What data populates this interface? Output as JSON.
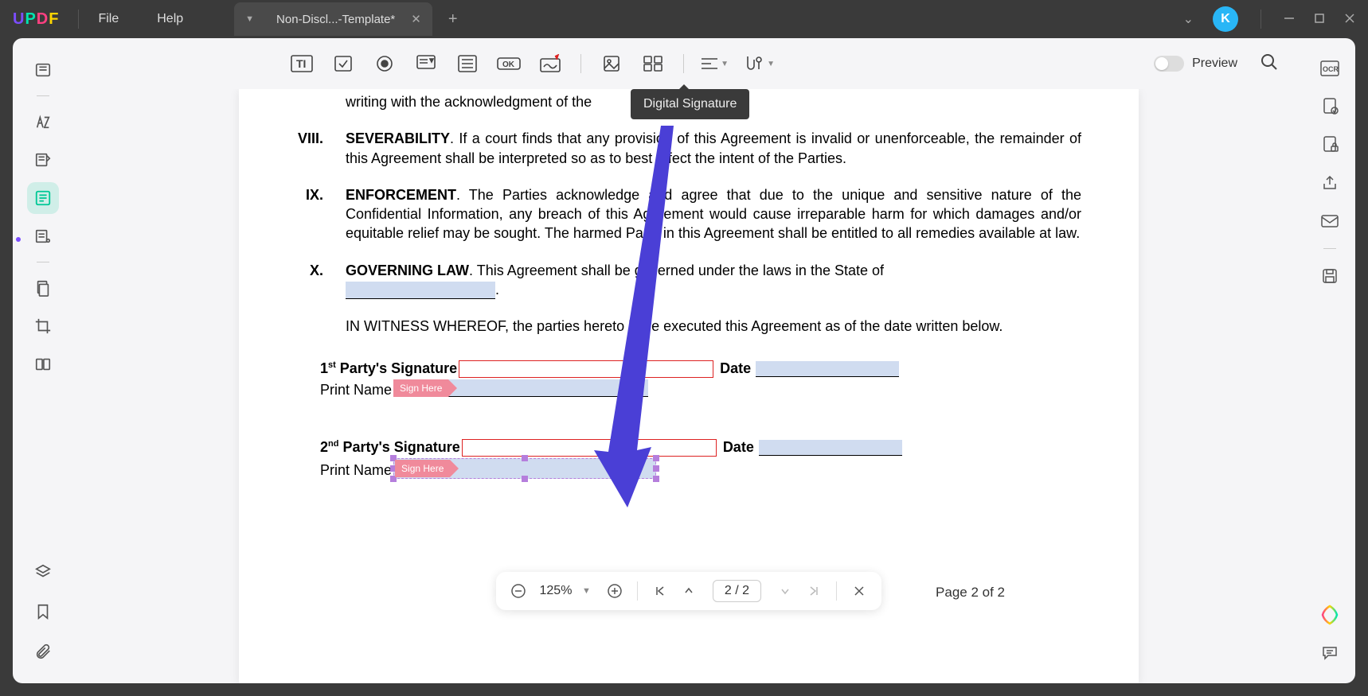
{
  "app": {
    "logo": "UPDF"
  },
  "menu": {
    "file": "File",
    "help": "Help"
  },
  "tab": {
    "title": "Non-Discl...-Template*"
  },
  "avatar": {
    "initial": "K"
  },
  "tooltip": {
    "digital_signature": "Digital Signature"
  },
  "preview": {
    "label": "Preview"
  },
  "document": {
    "writing_line": "writing with the acknowledgment of the",
    "sections": {
      "viii": {
        "num": "VIII.",
        "title": "SEVERABILITY",
        "body_after": ". If a court finds that any provision of this Agreement is invalid or unenforceable, the remainder of this Agreement shall be interpreted so as to best affect the intent of the Parties."
      },
      "ix": {
        "num": "IX.",
        "title": "ENFORCEMENT",
        "body_after": ". The Parties acknowledge and agree that due to the unique and sensitive nature of the Confidential Information, any breach of this Agreement would cause irreparable harm for which damages and/or equitable relief may be sought. The harmed Party in this Agreement shall be entitled to all remedies available at law."
      },
      "x": {
        "num": "X.",
        "title": "GOVERNING LAW",
        "body_after": ". This Agreement shall be governed under the laws in the State of "
      }
    },
    "witness": "IN WITNESS WHEREOF, the parties hereto have executed this Agreement as of the date written below.",
    "sig1": {
      "ord": "1",
      "sup": "st",
      "label": " Party's Signature",
      "date": "Date",
      "print": "Print Name",
      "sign_here": "Sign Here"
    },
    "sig2": {
      "ord": "2",
      "sup": "nd",
      "label": " Party's Signature",
      "date": "Date",
      "print": "Print Name",
      "sign_here": "Sign Here"
    }
  },
  "zoombar": {
    "zoom": "125%",
    "page_current": "2",
    "page_sep": " / ",
    "page_total_box": "2",
    "page_total_text": "Page 2 of 2"
  }
}
